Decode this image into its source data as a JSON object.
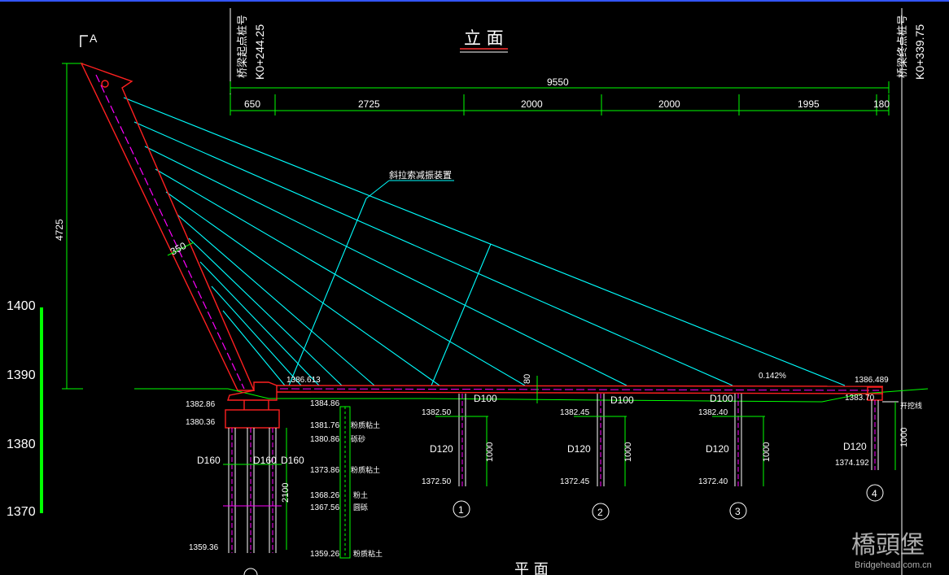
{
  "title": "立 面",
  "bottom_title": "平 面",
  "watermark": {
    "main": "橋頭堡",
    "sub": "Bridgehead.com.cn"
  },
  "section_mark": "A",
  "start_label": {
    "name": "桥梁起点桩号",
    "station": "K0+244.25"
  },
  "end_label": {
    "name": "桥梁终点桩号",
    "station": "K0+339.75"
  },
  "total_span": "9550",
  "spans": [
    "650",
    "2725",
    "2000",
    "2000",
    "1995",
    "180"
  ],
  "tower_height": "4725",
  "tower_width": "350",
  "damper_label": "斜拉索减振装置",
  "slope": "0.142%",
  "deck_depth": "80",
  "deck_left_elev": "1386.613",
  "deck_right_elev": "1386.489",
  "elevation_scale": [
    "1400",
    "1390",
    "1380",
    "1370"
  ],
  "abutment": {
    "top": "1382.86",
    "cap": "1380.36",
    "bottom": "1359.36",
    "pile_len": "2100",
    "piles": [
      "D160",
      "D160",
      "D160"
    ]
  },
  "geology": {
    "top": "1384.86",
    "layers": [
      {
        "elev": "1381.76",
        "name": "粉质粘土"
      },
      {
        "elev": "1380.86",
        "name": "砾砂"
      },
      {
        "elev": "1373.86",
        "name": "粉质粘土"
      },
      {
        "elev": "1368.26",
        "name": "粉土"
      },
      {
        "elev": "1367.56",
        "name": "圆砾"
      },
      {
        "elev": "1359.26",
        "name": "粉质粘土"
      }
    ]
  },
  "piers": [
    {
      "num": "1",
      "top": "1382.50",
      "bottom": "1372.50",
      "column": "D100",
      "pile": "D120",
      "len": "1000"
    },
    {
      "num": "2",
      "top": "1382.45",
      "bottom": "1372.45",
      "column": "D100",
      "pile": "D120",
      "len": "1000"
    },
    {
      "num": "3",
      "top": "1382.40",
      "bottom": "1372.40",
      "column": "D100",
      "pile": "D120",
      "len": "1000"
    }
  ],
  "end_abutment": {
    "num": "4",
    "top": "1383.70",
    "bottom": "1374.192",
    "pile": "D120",
    "len": "1000",
    "note": "开挖线"
  }
}
